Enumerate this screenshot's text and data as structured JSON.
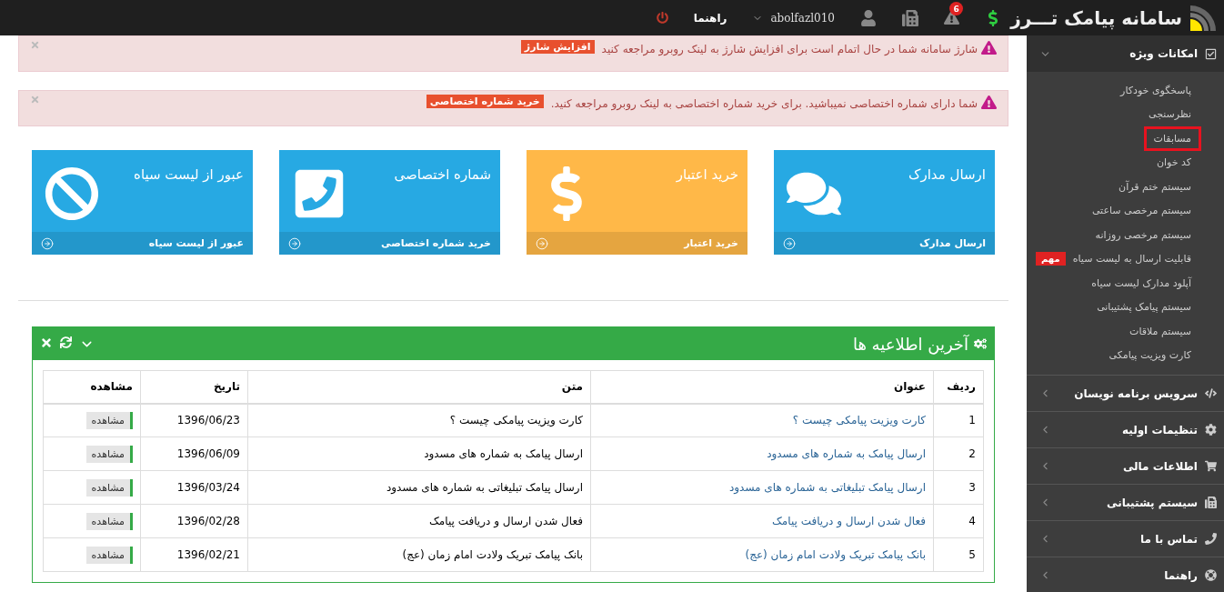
{
  "topbar": {
    "brand": "سامانه پیامک تـــرز",
    "help": "راهنما",
    "username": "abolfazl010",
    "alert_count": "6"
  },
  "sidebar": {
    "sections": [
      {
        "kind": "star",
        "label": "امکانات ویژه",
        "expanded": true,
        "items": [
          {
            "label": "پاسخگوی خودکار",
            "highlighted": false
          },
          {
            "label": "نظرسنجی",
            "highlighted": false
          },
          {
            "label": "مسابقات",
            "highlighted": true
          },
          {
            "label": "کد خوان",
            "highlighted": false
          },
          {
            "label": "سیستم ختم قرآن",
            "highlighted": false
          },
          {
            "label": "سیستم مرخصی ساعتی",
            "highlighted": false
          },
          {
            "label": "سیستم مرخصی روزانه",
            "highlighted": false
          },
          {
            "label": "قابلیت ارسال به لیست سیاه",
            "highlighted": false,
            "badge": "مهم"
          },
          {
            "label": "آپلود مدارک لیست سیاه",
            "highlighted": false
          },
          {
            "label": "سیستم پیامک پشتیبانی",
            "highlighted": false
          },
          {
            "label": "سیستم ملاقات",
            "highlighted": false
          },
          {
            "label": "کارت ویزیت پیامکی",
            "highlighted": false
          }
        ]
      },
      {
        "kind": "code",
        "label": "سرویس برنامه نویسان",
        "expanded": false
      },
      {
        "kind": "settings",
        "label": "تنظیمات اولیه",
        "expanded": false
      },
      {
        "kind": "cart",
        "label": "اطلاعات مالی",
        "expanded": false
      },
      {
        "kind": "fax",
        "label": "سیستم پشتیبانی",
        "expanded": false
      },
      {
        "kind": "phone",
        "label": "تماس با ما",
        "expanded": false
      },
      {
        "kind": "help",
        "label": "راهنما",
        "expanded": false
      }
    ]
  },
  "alerts": [
    {
      "text": "شارژ سامانه شما در حال اتمام است برای افزایش شارژ به لینک روبرو مراجعه کنید",
      "action": "افزایش شارژ"
    },
    {
      "text": "شما دارای شماره اختصاصی نمیباشید. برای خرید شماره اختصاصی به لینک روبرو مراجعه کنید.",
      "action": "خرید شماره اختصاصی"
    }
  ],
  "tiles": [
    {
      "kind": "chat",
      "title": "ارسال مدارک",
      "link": "ارسال مدارک",
      "color": "#27a9e3"
    },
    {
      "kind": "dollar",
      "title": "خرید اعتبار",
      "link": "خرید اعتبار",
      "color": "#ffb848"
    },
    {
      "kind": "phone",
      "title": "شماره اختصاصی",
      "link": "خرید شماره اختصاصی",
      "color": "#27a9e3"
    },
    {
      "kind": "ban",
      "title": "عبور از لیست سیاه",
      "link": "عبور از لیست سیاه",
      "color": "#27a9e3"
    }
  ],
  "news_panel": {
    "title": "آخرین اطلاعیه ها",
    "columns": [
      "ردیف",
      "عنوان",
      "متن",
      "تاریخ",
      "مشاهده"
    ],
    "rows": [
      {
        "index": "1",
        "title": "کارت ویزیت پیامکی چیست ؟",
        "text": "کارت ویزیت پیامکی چیست ؟",
        "date": "1396/06/23",
        "action": "مشاهده"
      },
      {
        "index": "2",
        "title": "ارسال پیامک به شماره های مسدود",
        "text": "ارسال پیامک به شماره های مسدود",
        "date": "1396/06/09",
        "action": "مشاهده"
      },
      {
        "index": "3",
        "title": "ارسال پیامک تبلیغاتی به شماره های مسدود",
        "text": "ارسال پیامک تبلیغاتی به شماره های مسدود",
        "date": "1396/03/24",
        "action": "مشاهده"
      },
      {
        "index": "4",
        "title": "فعال شدن ارسال و دریافت پیامک",
        "text": "فعال شدن ارسال و دریافت پیامک",
        "date": "1396/02/28",
        "action": "مشاهده"
      },
      {
        "index": "5",
        "title": "بانک پیامک تبریک ولادت امام زمان (عج)",
        "text": "بانک پیامک تبریک ولادت امام زمان (عج)",
        "date": "1396/02/21",
        "action": "مشاهده"
      }
    ]
  }
}
